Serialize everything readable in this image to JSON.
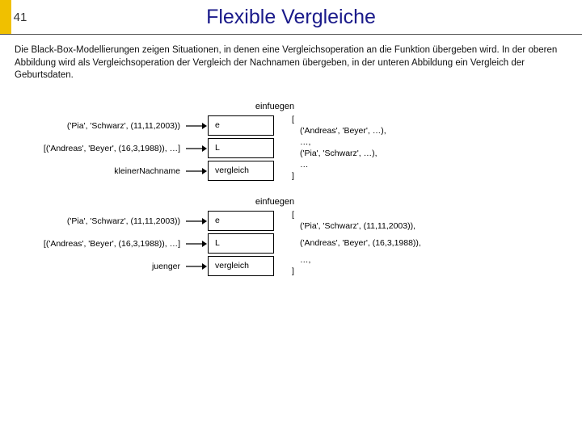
{
  "header": {
    "slide_number": "41",
    "title": "Flexible Vergleiche"
  },
  "body": {
    "text": "Die Black-Box-Modellierungen zeigen Situationen, in denen eine Vergleichsoperation an die Funktion übergeben wird. In der oberen Abbildung wird als Vergleichsoperation der Vergleich der Nachnamen übergeben, in der unteren Abbildung ein Vergleich der Geburtsdaten."
  },
  "diagram1": {
    "title": "einfuegen",
    "row1_left": "('Pia', 'Schwarz', (11,11,2003))",
    "row1_cell": "e",
    "row2_left": "[('Andreas', 'Beyer', (16,3,1988)), …]",
    "row2_cell": "L",
    "row3_left": "kleinerNachname",
    "row3_cell": "vergleich",
    "out_l1": "[",
    "out_l2": "('Andreas', 'Beyer', …),",
    "out_l3": "…,",
    "out_l4": "('Pia', 'Schwarz', …),",
    "out_l5": "…",
    "out_l6": "]"
  },
  "diagram2": {
    "title": "einfuegen",
    "row1_left": "('Pia', 'Schwarz', (11,11,2003))",
    "row1_cell": "e",
    "row2_left": "[('Andreas', 'Beyer', (16,3,1988)), …]",
    "row2_cell": "L",
    "row3_left": "juenger",
    "row3_cell": "vergleich",
    "out_l1": "[",
    "out_l2": "('Pia', 'Schwarz', (11,11,2003)),",
    "out_l3": "('Andreas', 'Beyer', (16,3,1988)),",
    "out_l4": "…,",
    "out_l5": "]"
  }
}
